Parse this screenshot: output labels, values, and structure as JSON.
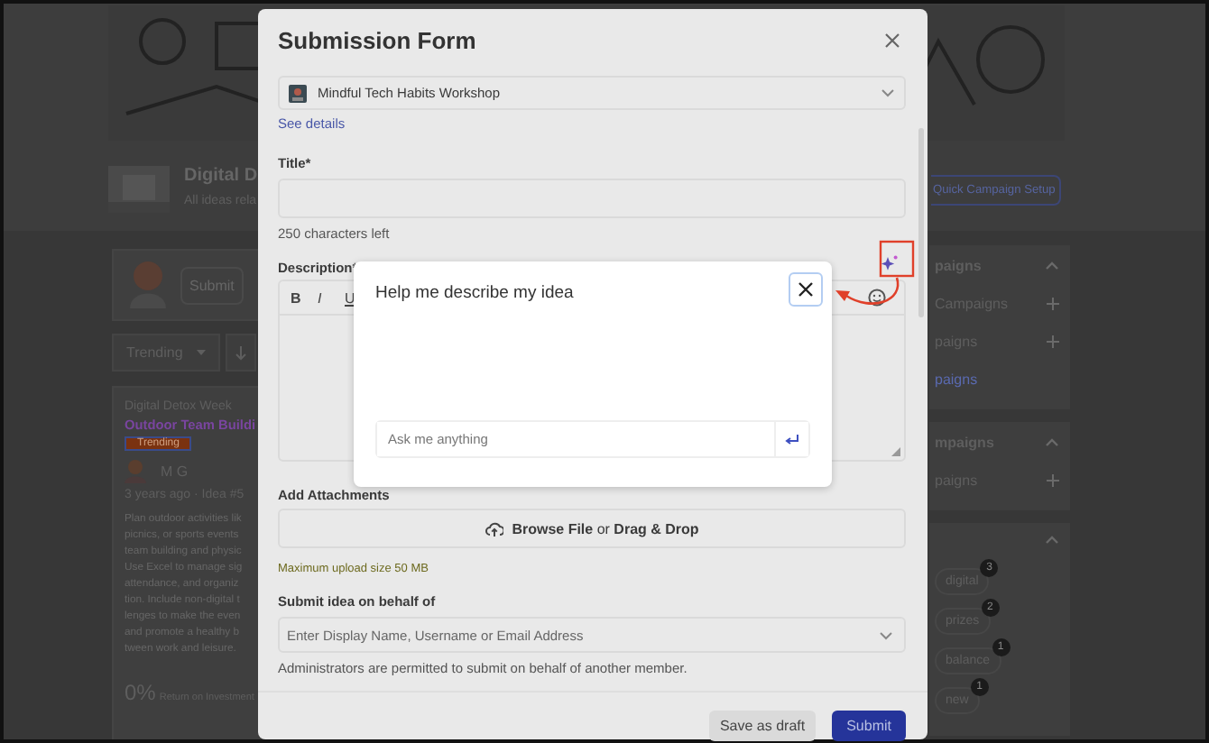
{
  "background": {
    "page_title": "Digital D",
    "page_subtitle": "All ideas rela",
    "quick_setup_button": "Quick Campaign Setup",
    "composer": {
      "button": "Submit"
    },
    "sort": {
      "label": "Trending"
    },
    "idea": {
      "campaign": "Digital Detox Week",
      "title": "Outdoor Team Buildi",
      "badge": "Trending",
      "author": "M G",
      "meta": "3 years ago · Idea #5",
      "body_lines": [
        "Plan outdoor activities lik",
        "picnics, or sports events",
        "team building and physic",
        "Use Excel to manage sig",
        "attendance, and organiz",
        "tion. Include non-digital t",
        "lenges to make the even",
        "and promote a healthy b",
        "tween work and leisure."
      ],
      "roi_value": "0%",
      "roi_label": "Return on Investment"
    },
    "panels": [
      {
        "heading": "paigns",
        "items": [
          {
            "label": "Campaigns",
            "kind": "add"
          },
          {
            "label": "paigns",
            "kind": "add"
          },
          {
            "label": "paigns",
            "kind": "link"
          }
        ]
      },
      {
        "heading": "mpaigns",
        "items": [
          {
            "label": "paigns",
            "kind": "add"
          }
        ]
      },
      {
        "tags": [
          {
            "label": "digital",
            "count": "3"
          },
          {
            "label": "prizes",
            "count": "2"
          },
          {
            "label": "balance",
            "count": "1"
          },
          {
            "label": "new",
            "count": "1"
          }
        ]
      }
    ]
  },
  "submission_form": {
    "title": "Submission Form",
    "campaign_select": {
      "value": "Mindful Tech Habits Workshop"
    },
    "see_details_link": "See details",
    "title_field": {
      "label": "Title*",
      "counter": "250 characters left"
    },
    "description_field": {
      "label": "Description*",
      "toolbar": [
        "B",
        "I",
        "U"
      ]
    },
    "attachments": {
      "label": "Add Attachments",
      "dropzone": "**Browse File** or **Drag & Drop**",
      "note": "Maximum upload size 50 MB"
    },
    "on_behalf": {
      "label": "Submit idea on behalf of",
      "placeholder": "Enter Display Name, Username or Email Address",
      "note": "Administrators are permitted to submit on behalf of another member."
    },
    "buttons": [
      {
        "label": "Save as draft",
        "kind": "secondary"
      },
      {
        "label": "Submit",
        "kind": "primary"
      }
    ]
  },
  "assistant_popup": {
    "title": "Help me describe my idea",
    "input": {
      "placeholder": "Ask me anything"
    }
  }
}
